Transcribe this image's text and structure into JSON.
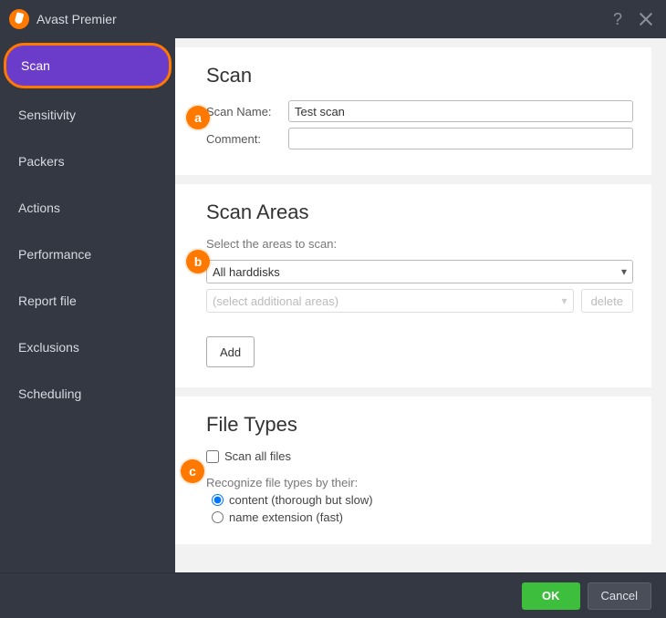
{
  "titlebar": {
    "title": "Avast Premier"
  },
  "sidebar": {
    "items": [
      {
        "label": "Scan"
      },
      {
        "label": "Sensitivity"
      },
      {
        "label": "Packers"
      },
      {
        "label": "Actions"
      },
      {
        "label": "Performance"
      },
      {
        "label": "Report file"
      },
      {
        "label": "Exclusions"
      },
      {
        "label": "Scheduling"
      }
    ]
  },
  "scan": {
    "heading": "Scan",
    "name_label": "Scan Name:",
    "name_value": "Test scan",
    "comment_label": "Comment:",
    "comment_value": ""
  },
  "areas": {
    "heading": "Scan Areas",
    "hint": "Select the areas to scan:",
    "selected": "All harddisks",
    "additional_placeholder": "(select additional areas)",
    "delete_label": "delete",
    "add_label": "Add"
  },
  "filetypes": {
    "heading": "File Types",
    "scan_all_label": "Scan all files",
    "recognize_label": "Recognize file types by their:",
    "opt_content": "content (thorough but slow)",
    "opt_name": "name extension (fast)"
  },
  "footer": {
    "ok": "OK",
    "cancel": "Cancel"
  },
  "callouts": {
    "a": "a",
    "b": "b",
    "c": "c"
  }
}
